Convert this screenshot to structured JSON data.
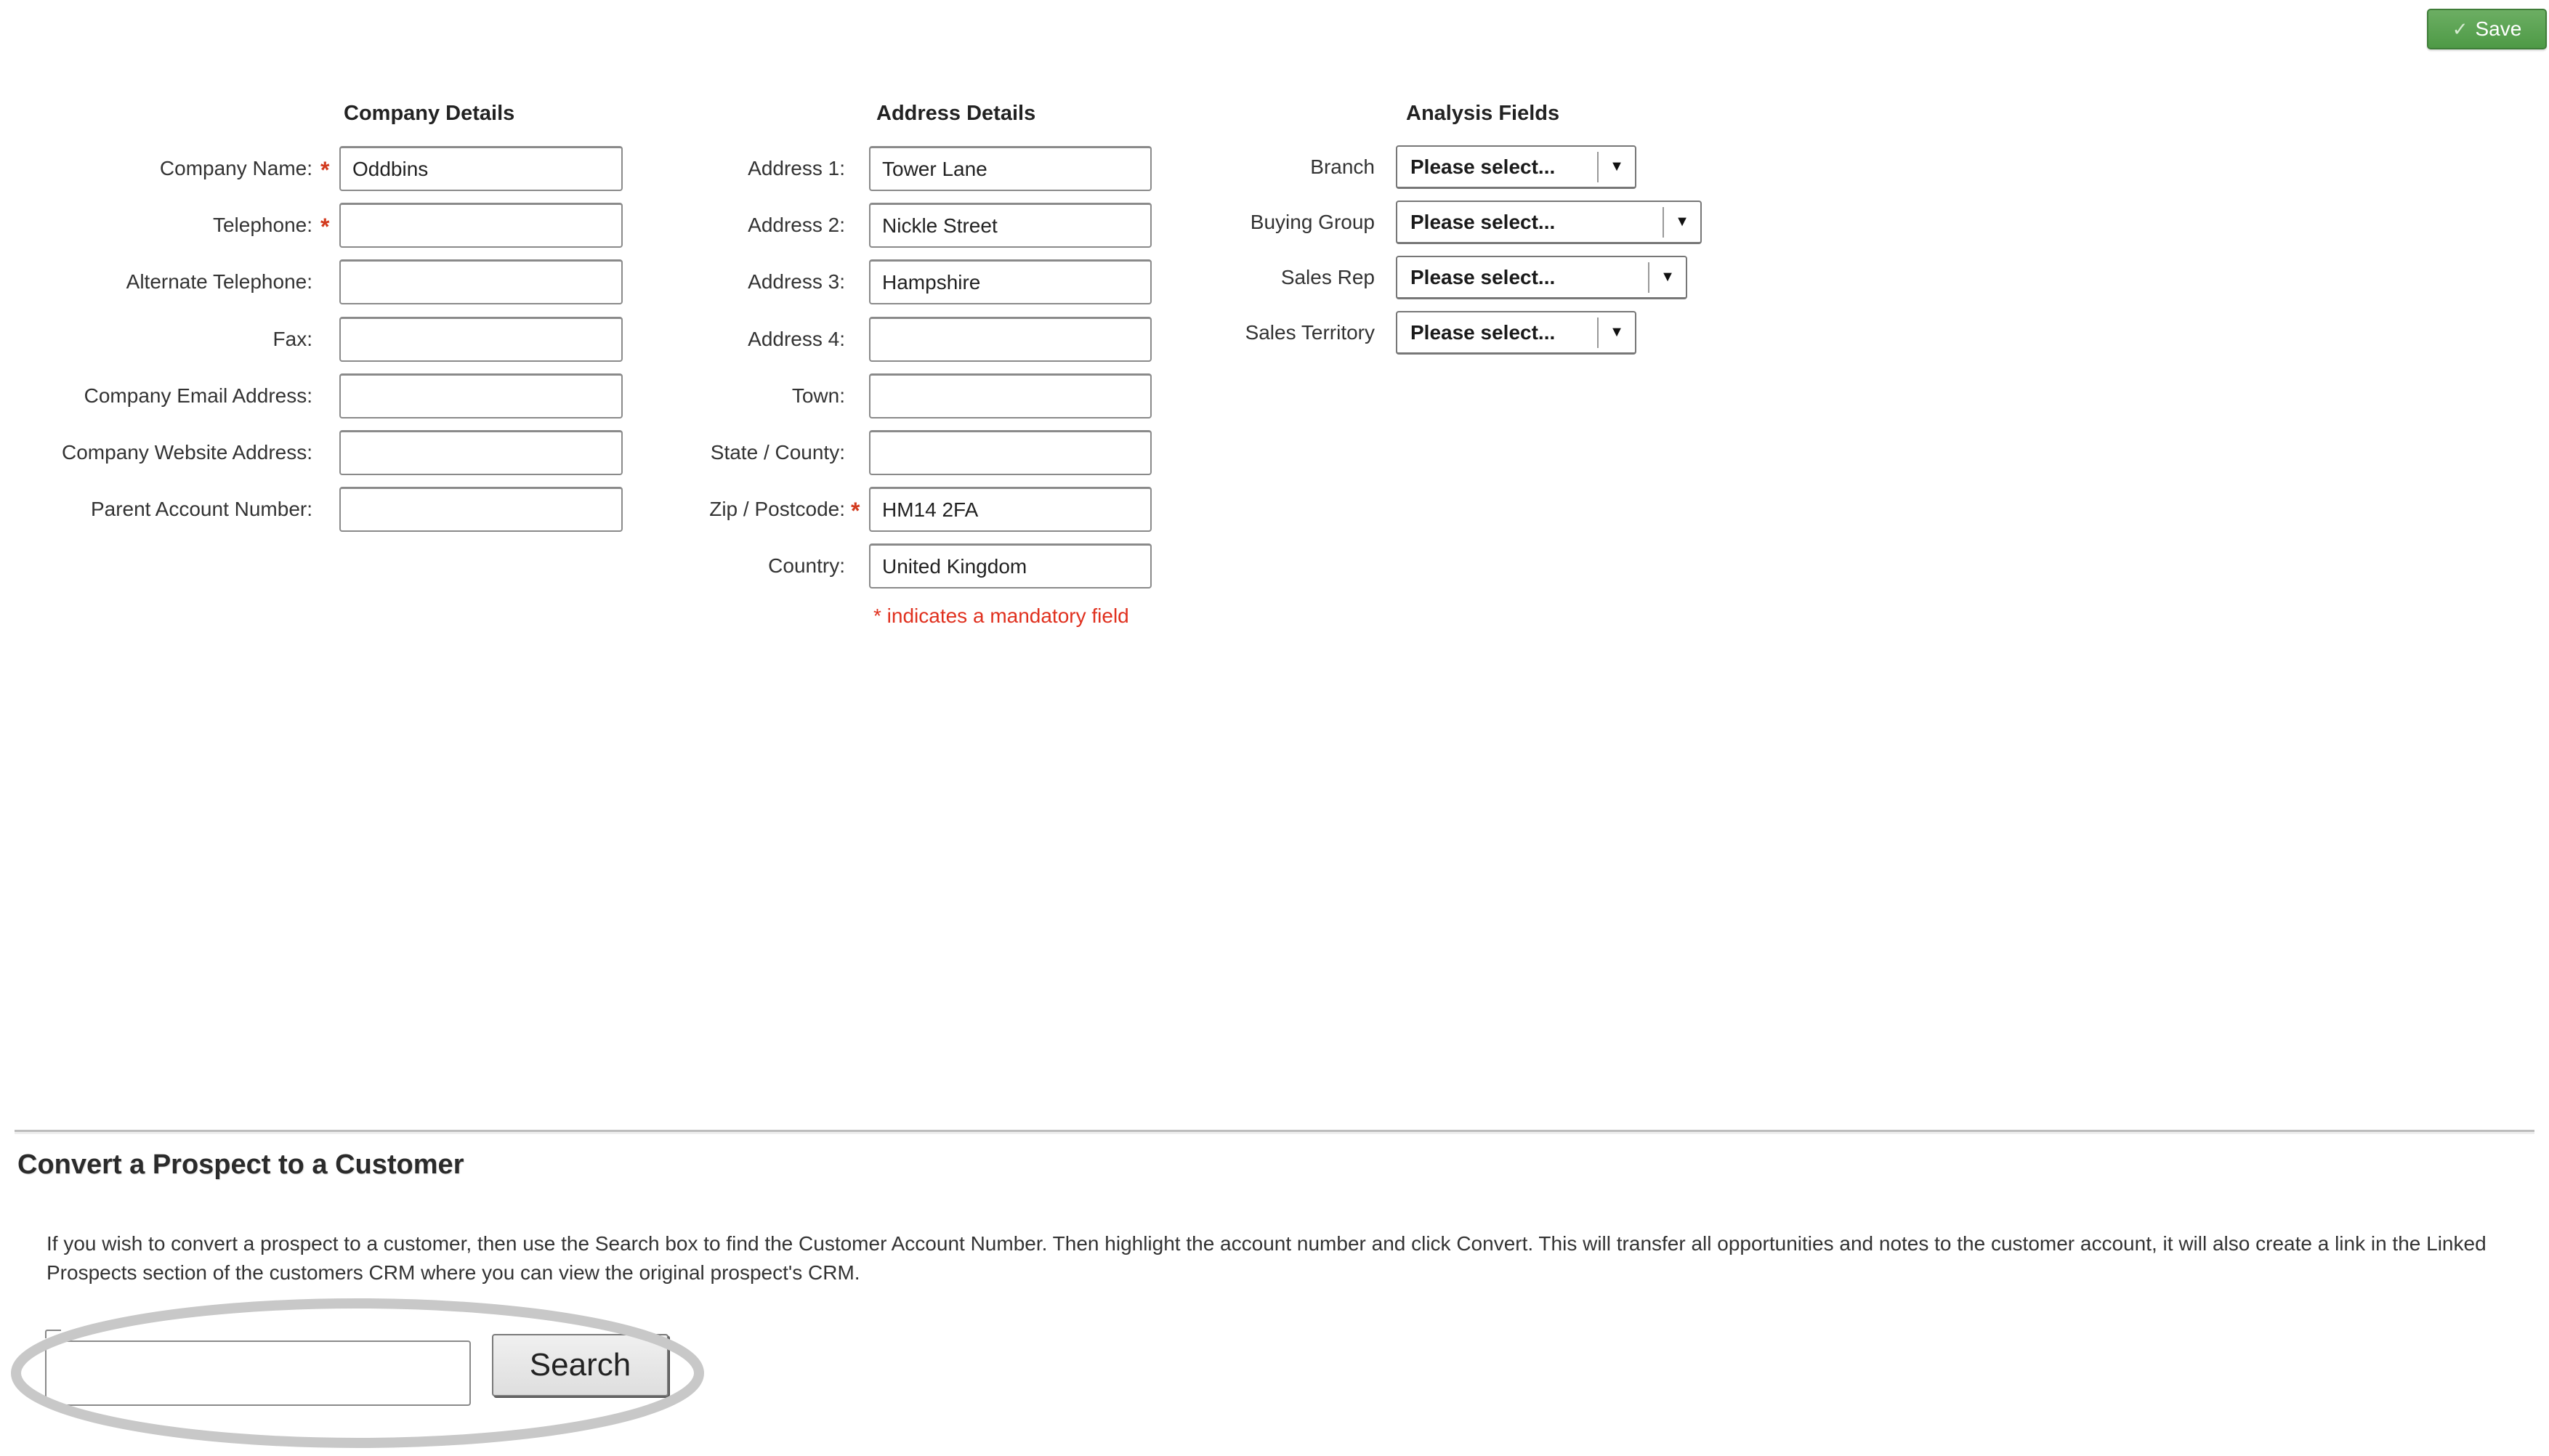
{
  "toolbar": {
    "save_label": "Save",
    "save_icon": "checkmark-icon",
    "save_color": "#5aa351"
  },
  "company": {
    "title": "Company Details",
    "fields": [
      {
        "label": "Company Name:",
        "value": "Oddbins",
        "required": true
      },
      {
        "label": "Telephone:",
        "value": "",
        "required": true
      },
      {
        "label": "Alternate Telephone:",
        "value": "",
        "required": false
      },
      {
        "label": "Fax:",
        "value": "",
        "required": false
      },
      {
        "label": "Company Email Address:",
        "value": "",
        "required": false
      },
      {
        "label": "Company Website Address:",
        "value": "",
        "required": false
      },
      {
        "label": "Parent Account Number:",
        "value": "",
        "required": false
      }
    ]
  },
  "address": {
    "title": "Address Details",
    "fields": [
      {
        "label": "Address 1:",
        "value": "Tower Lane",
        "required": false
      },
      {
        "label": "Address 2:",
        "value": "Nickle Street",
        "required": false
      },
      {
        "label": "Address 3:",
        "value": "Hampshire",
        "required": false
      },
      {
        "label": "Address 4:",
        "value": "",
        "required": false
      },
      {
        "label": "Town:",
        "value": "",
        "required": false
      },
      {
        "label": "State / County:",
        "value": "",
        "required": false
      },
      {
        "label": "Zip / Postcode:",
        "value": "HM14 2FA",
        "required": true
      },
      {
        "label": "Country:",
        "value": "United Kingdom",
        "required": false
      }
    ],
    "mandatory_note": "* indicates a mandatory field",
    "required_marker": "*",
    "required_color": "#d23a1e"
  },
  "analysis": {
    "title": "Analysis Fields",
    "fields": [
      {
        "label": "Branch",
        "selected": "Please select..."
      },
      {
        "label": "Buying Group",
        "selected": "Please select..."
      },
      {
        "label": "Sales Rep",
        "selected": "Please select..."
      },
      {
        "label": "Sales Territory",
        "selected": "Please select..."
      }
    ],
    "arrow_glyph": "▼"
  },
  "convert": {
    "title": "Convert a Prospect to a Customer",
    "description": "If you wish to convert a prospect to a customer, then use the Search box to find the Customer Account Number. Then highlight the account number and click Convert. This will transfer all opportunities and notes to the customer account, it will also create a link in the Linked Prospects section of the customers CRM where you can view the original prospect's CRM.",
    "search_value": "",
    "search_button_label": "Search",
    "highlight_color": "#c8c8c8"
  }
}
